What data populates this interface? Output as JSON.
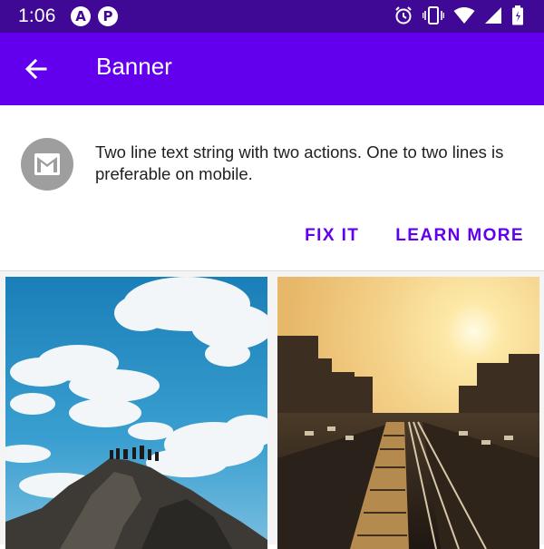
{
  "status_bar": {
    "time": "1:06",
    "left_icons": [
      {
        "name": "a-icon",
        "glyph": "A"
      },
      {
        "name": "p-icon",
        "glyph": "P"
      }
    ],
    "right_icons": [
      "alarm-icon",
      "vibrate-icon",
      "wifi-icon",
      "signal-icon",
      "battery-icon"
    ],
    "background": "#3f0996"
  },
  "app_bar": {
    "title": "Banner",
    "nav_icon": "arrow-back-icon",
    "background": "#6200ee"
  },
  "banner": {
    "icon": "mail-icon",
    "text": "Two line text string with two actions. One to two lines is preferable on mobile.",
    "actions": [
      "FIX IT",
      "LEARN MORE"
    ],
    "accent": "#6200ee"
  },
  "photos": [
    {
      "name": "photo-mountain-sky"
    },
    {
      "name": "photo-city-train-sunset"
    }
  ]
}
